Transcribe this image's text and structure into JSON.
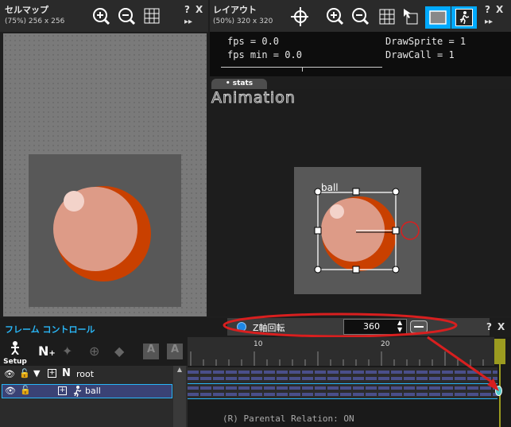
{
  "cellmap": {
    "title": "セルマップ",
    "subtitle": "(75%) 256 x 256",
    "help_label": "?",
    "close_label": "X",
    "expand_label": "▸▸",
    "icons": [
      "zoom-in-icon",
      "zoom-out-icon",
      "grid-icon"
    ]
  },
  "layout": {
    "title": "レイアウト",
    "subtitle": "(50%) 320 x 320",
    "help_label": "?",
    "close_label": "X",
    "expand_label": "▸▸",
    "icons": [
      "crosshair-icon",
      "zoom-in-icon",
      "zoom-out-icon",
      "grid-icon",
      "cursor-box-icon",
      "frame-icon",
      "running-figure-icon"
    ],
    "stats": {
      "fps": "fps = 0.0",
      "fps_min": "fps min = 0.0",
      "draw_sprite": "DrawSprite = 1",
      "draw_call": "DrawCall = 1"
    },
    "stats_tab": "• stats",
    "animation_label": "Animation",
    "sprite_label": "ball"
  },
  "frame_control": {
    "title": "フレーム コントロール",
    "setup_label": "Setup",
    "help_label": "?",
    "close_label": "X",
    "property_name": "Z軸回転",
    "property_value": "360",
    "ruler_ticks": [
      "10",
      "20"
    ],
    "layers": [
      {
        "name": "root",
        "type": "N"
      },
      {
        "name": "ball",
        "type": "sprite"
      }
    ],
    "status_text": "(R) Parental Relation: ON"
  },
  "colors": {
    "accent": "#00aaff",
    "highlight_red": "#d81f1f",
    "ball_orange": "#d04000",
    "ball_light": "#f0a990",
    "keyframe_green": "#4aa"
  }
}
